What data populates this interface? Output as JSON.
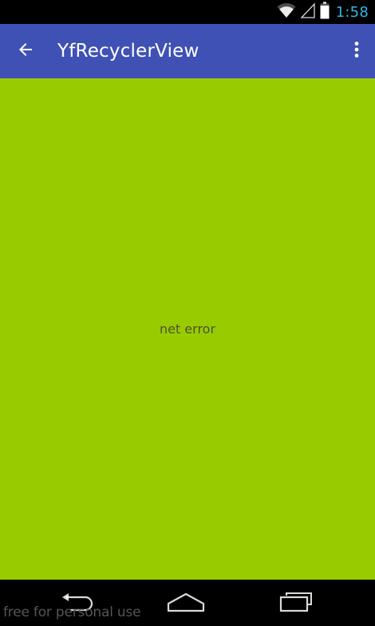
{
  "status_bar": {
    "time": "1:58",
    "icons": [
      "wifi-icon",
      "signal-icon",
      "battery-icon"
    ],
    "accent_color": "#33b5e5"
  },
  "app_bar": {
    "title": "YfRecyclerView",
    "navigation_icon": "arrow-back-icon",
    "menu_icon": "more-vert-icon",
    "background_color": "#3f51b5"
  },
  "content": {
    "message": "net error",
    "background_color": "#99cc00"
  },
  "nav_bar": {
    "buttons": [
      "back-icon",
      "home-icon",
      "recents-icon"
    ]
  },
  "watermark": {
    "text": "free for personal use"
  }
}
